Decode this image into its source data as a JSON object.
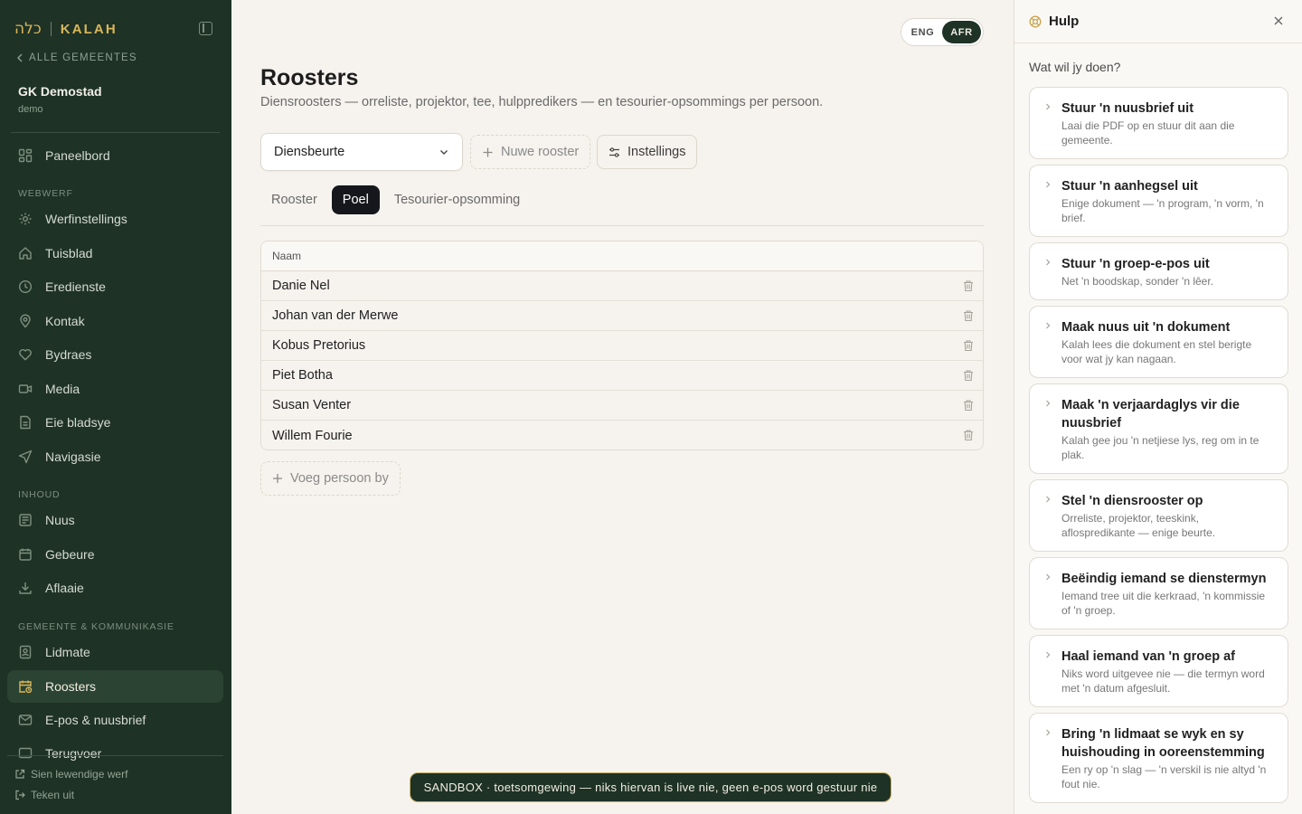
{
  "brand": {
    "hebrew": "כלה",
    "name": "KALAH"
  },
  "sidebar": {
    "back_label": "ALLE GEMEENTES",
    "org_name": "GK Demostad",
    "org_slug": "demo",
    "dashboard": "Paneelbord",
    "sections": [
      "WEBWERF",
      "INHOUD",
      "GEMEENTE & KOMMUNIKASIE"
    ],
    "items": [
      "Werfinstellings",
      "Tuisblad",
      "Eredienste",
      "Kontak",
      "Bydraes",
      "Media",
      "Eie bladsye",
      "Navigasie",
      "Nuus",
      "Gebeure",
      "Aflaaie",
      "Lidmate",
      "Roosters",
      "E-pos & nuusbrief",
      "Terugvoer"
    ],
    "active_item": "Roosters",
    "footer": {
      "live_site": "Sien lewendige werf",
      "logout": "Teken uit"
    }
  },
  "lang": {
    "eng": "ENG",
    "afr": "AFR",
    "active": "AFR"
  },
  "page": {
    "title": "Roosters",
    "subtitle": "Diensroosters — orreliste, projektor, tee, hulppredikers — en tesourier-opsommings per persoon."
  },
  "toolbar": {
    "selected_roster": "Diensbeurte",
    "new_roster": "Nuwe rooster",
    "settings": "Instellings"
  },
  "tabs": [
    "Rooster",
    "Poel",
    "Tesourier-opsomming"
  ],
  "active_tab": "Poel",
  "pool_table": {
    "header": "Naam",
    "rows": [
      "Danie Nel",
      "Johan van der Merwe",
      "Kobus Pretorius",
      "Piet Botha",
      "Susan Venter",
      "Willem Fourie"
    ]
  },
  "add_person": "Voeg persoon by",
  "help": {
    "title": "Hulp",
    "question": "Wat wil jy doen?",
    "cards": [
      {
        "title": "Stuur 'n nuusbrief uit",
        "desc": "Laai die PDF op en stuur dit aan die gemeente."
      },
      {
        "title": "Stuur 'n aanhegsel uit",
        "desc": "Enige dokument — 'n program, 'n vorm, 'n brief."
      },
      {
        "title": "Stuur 'n groep-e-pos uit",
        "desc": "Net 'n boodskap, sonder 'n lêer."
      },
      {
        "title": "Maak nuus uit 'n dokument",
        "desc": "Kalah lees die dokument en stel berigte voor wat jy kan nagaan."
      },
      {
        "title": "Maak 'n verjaardaglys vir die nuusbrief",
        "desc": "Kalah gee jou 'n netjiese lys, reg om in te plak."
      },
      {
        "title": "Stel 'n diensrooster op",
        "desc": "Orreliste, projektor, teeskink, aflospredikante — enige beurte."
      },
      {
        "title": "Beëindig iemand se dienstermyn",
        "desc": "Iemand tree uit die kerkraad, 'n kommissie of 'n groep."
      },
      {
        "title": "Haal iemand van 'n groep af",
        "desc": "Niks word uitgevee nie — die termyn word met 'n datum afgesluit."
      },
      {
        "title": "Bring 'n lidmaat se wyk en sy huishouding in ooreenstemming",
        "desc": "Een ry op 'n slag — 'n verskil is nie altyd 'n fout nie."
      }
    ]
  },
  "sandbox_banner": "SANDBOX · toetsomgewing — niks hiervan is live nie, geen e-pos word gestuur nie",
  "colors": {
    "sidebar_bg": "#1e3226",
    "accent_gold": "#d9b75a",
    "page_bg": "#f6f3ee"
  }
}
